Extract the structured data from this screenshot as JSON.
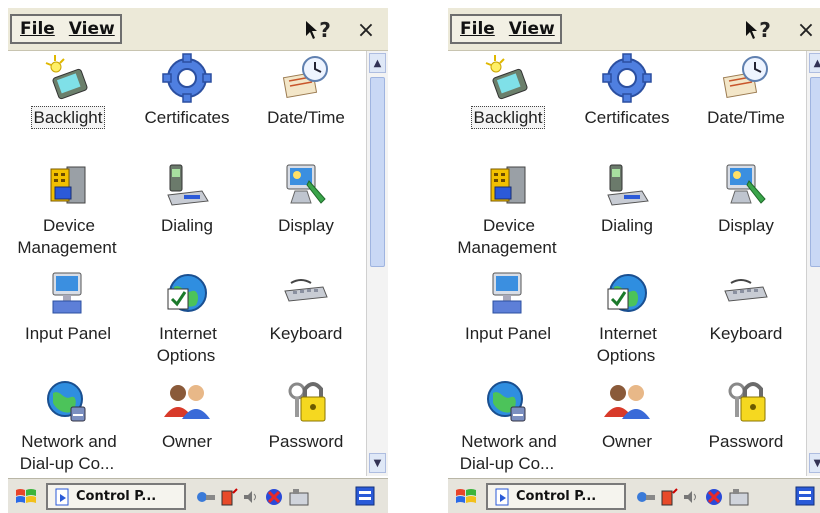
{
  "screens": [
    {
      "menu": {
        "file": "File",
        "view": "View"
      },
      "help_label": "?",
      "close_label": "×",
      "items": [
        {
          "label": "Backlight",
          "icon": "backlight-icon",
          "selected": true
        },
        {
          "label": "Certificates",
          "icon": "certificates-icon"
        },
        {
          "label": "Date/Time",
          "icon": "date-time-icon"
        },
        {
          "label": "Device Management",
          "icon": "device-management-icon"
        },
        {
          "label": "Dialing",
          "icon": "dialing-icon"
        },
        {
          "label": "Display",
          "icon": "display-icon"
        },
        {
          "label": "Input Panel",
          "icon": "input-panel-icon"
        },
        {
          "label": "Internet Options",
          "icon": "internet-options-icon"
        },
        {
          "label": "Keyboard",
          "icon": "keyboard-icon"
        },
        {
          "label": "Network and Dial-up Co...",
          "icon": "network-icon"
        },
        {
          "label": "Owner",
          "icon": "owner-icon"
        },
        {
          "label": "Password",
          "icon": "password-icon"
        }
      ],
      "taskbar": {
        "task_label": "Control P..."
      }
    },
    {
      "menu": {
        "file": "File",
        "view": "View"
      },
      "help_label": "?",
      "close_label": "×",
      "items": [
        {
          "label": "Backlight",
          "icon": "backlight-icon",
          "selected": true
        },
        {
          "label": "Certificates",
          "icon": "certificates-icon"
        },
        {
          "label": "Date/Time",
          "icon": "date-time-icon"
        },
        {
          "label": "Device Management",
          "icon": "device-management-icon"
        },
        {
          "label": "Dialing",
          "icon": "dialing-icon"
        },
        {
          "label": "Display",
          "icon": "display-icon"
        },
        {
          "label": "Input Panel",
          "icon": "input-panel-icon"
        },
        {
          "label": "Internet Options",
          "icon": "internet-options-icon"
        },
        {
          "label": "Keyboard",
          "icon": "keyboard-icon"
        },
        {
          "label": "Network and Dial-up Co...",
          "icon": "network-icon"
        },
        {
          "label": "Owner",
          "icon": "owner-icon"
        },
        {
          "label": "Password",
          "icon": "password-icon"
        }
      ],
      "taskbar": {
        "task_label": "Control P..."
      }
    }
  ]
}
